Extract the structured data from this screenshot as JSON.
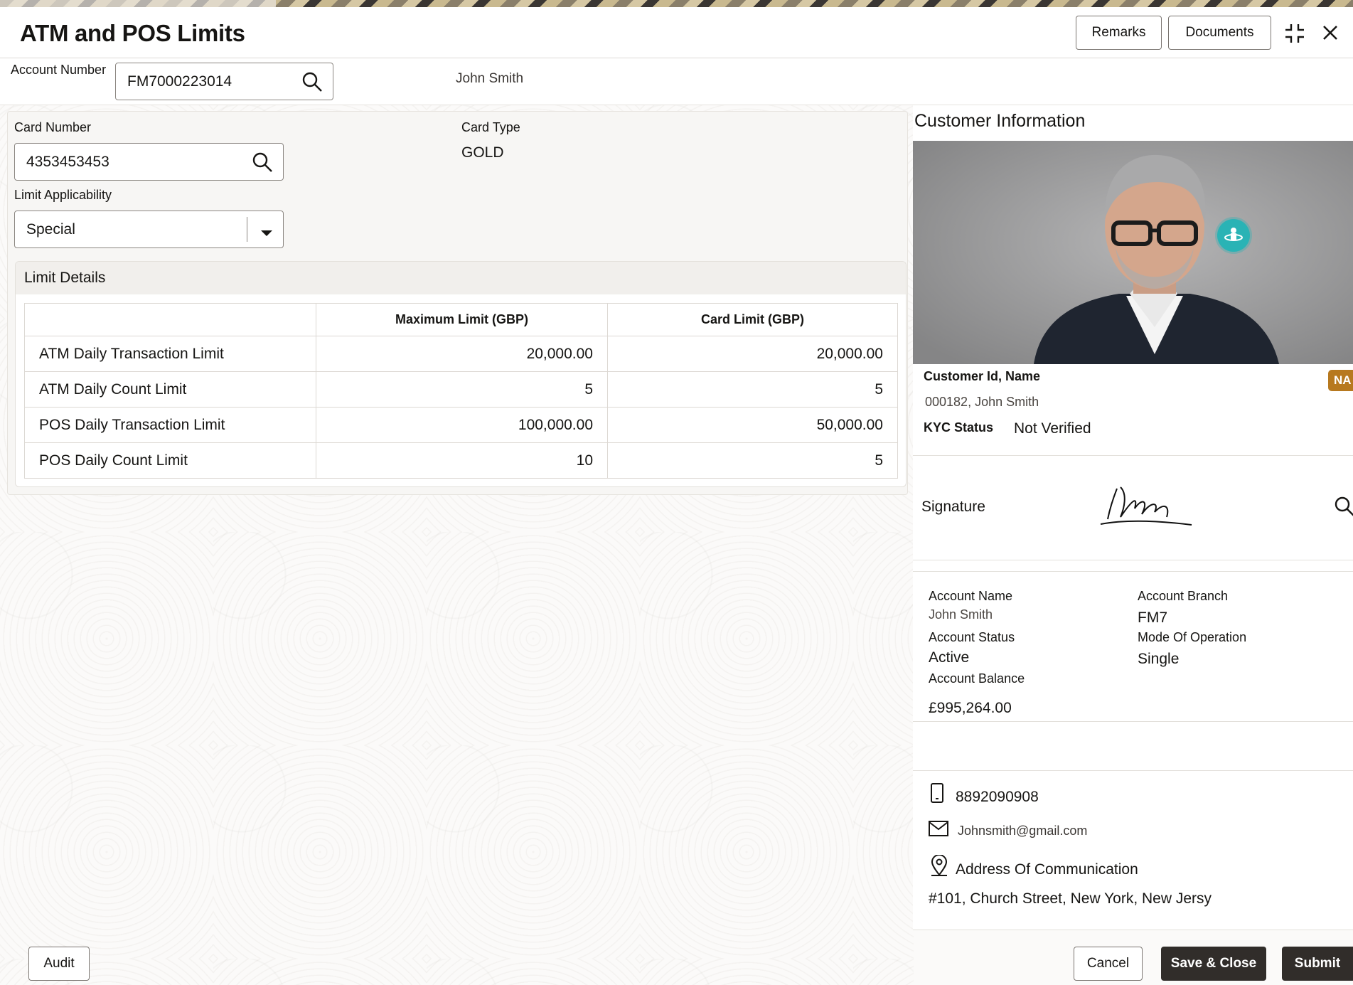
{
  "header": {
    "title": "ATM and POS Limits",
    "remarks_label": "Remarks",
    "documents_label": "Documents"
  },
  "account": {
    "label": "Account Number",
    "value": "FM7000223014",
    "holder_name": "John Smith"
  },
  "card": {
    "card_number_label": "Card Number",
    "card_number_value": "4353453453",
    "card_type_label": "Card Type",
    "card_type_value": "GOLD",
    "limit_applicability_label": "Limit Applicability",
    "limit_applicability_value": "Special"
  },
  "limit_details": {
    "title": "Limit Details",
    "columns": [
      "",
      "Maximum Limit (GBP)",
      "Card Limit (GBP)"
    ],
    "rows": [
      {
        "name": "ATM Daily Transaction Limit",
        "max": "20,000.00",
        "card": "20,000.00"
      },
      {
        "name": "ATM Daily Count Limit",
        "max": "5",
        "card": "5"
      },
      {
        "name": "POS Daily Transaction Limit",
        "max": "100,000.00",
        "card": "50,000.00"
      },
      {
        "name": "POS Daily Count Limit",
        "max": "10",
        "card": "5"
      }
    ]
  },
  "customer": {
    "section_title": "Customer Information",
    "id_name_label": "Customer Id, Name",
    "id_name_value": "000182, John Smith",
    "badge": "NA",
    "kyc_label": "KYC Status",
    "kyc_value": "Not Verified",
    "signature_label": "Signature"
  },
  "account_info": {
    "name_label": "Account Name",
    "name_value": "John Smith",
    "branch_label": "Account Branch",
    "branch_value": "FM7",
    "status_label": "Account Status",
    "status_value": "Active",
    "mode_label": "Mode Of Operation",
    "mode_value": "Single",
    "balance_label": "Account Balance",
    "balance_value": "£995,264.00"
  },
  "contact": {
    "phone": "8892090908",
    "email": "Johnsmith@gmail.com",
    "address_label": "Address Of Communication",
    "address_value": "#101, Church Street, New York, New Jersy"
  },
  "footer": {
    "audit_label": "Audit",
    "cancel_label": "Cancel",
    "save_close_label": "Save & Close",
    "submit_label": "Submit"
  },
  "colors": {
    "primary_dark": "#312d2a",
    "badge_bg": "#b7791f",
    "avatar_teal": "#2ab3b5"
  }
}
